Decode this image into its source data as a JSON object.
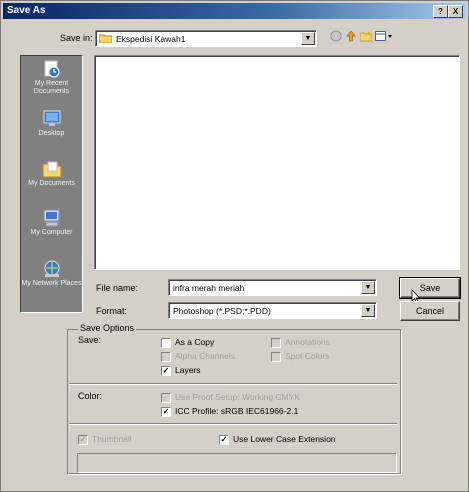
{
  "window": {
    "title": "Save As",
    "help_button": "?",
    "close_button": "X"
  },
  "save_in": {
    "label": "Save in:",
    "value": "Ekspedisi Kawah1"
  },
  "places": [
    {
      "label": "My Recent Documents",
      "icon": "recent-documents-icon"
    },
    {
      "label": "Desktop",
      "icon": "desktop-icon"
    },
    {
      "label": "My Documents",
      "icon": "my-documents-icon"
    },
    {
      "label": "My Computer",
      "icon": "my-computer-icon"
    },
    {
      "label": "My Network Places",
      "icon": "network-places-icon"
    }
  ],
  "file_name": {
    "label": "File name:",
    "value": "infra merah meriah"
  },
  "format": {
    "label": "Format:",
    "value": "Photoshop (*.PSD;*.PDD)"
  },
  "buttons": {
    "save": "Save",
    "cancel": "Cancel"
  },
  "save_options": {
    "group_label": "Save Options",
    "save_label": "Save:",
    "as_a_copy": {
      "label": "As a Copy",
      "checked": false,
      "enabled": true
    },
    "alpha_channels": {
      "label": "Alpha Channels",
      "checked": false,
      "enabled": false
    },
    "layers": {
      "label": "Layers",
      "checked": true,
      "enabled": true
    },
    "annotations": {
      "label": "Annotations",
      "checked": false,
      "enabled": false
    },
    "spot_colors": {
      "label": "Spot Colors",
      "checked": false,
      "enabled": false
    }
  },
  "color": {
    "label": "Color:",
    "use_proof_setup": {
      "label": "Use Proof Setup:  Working CMYK",
      "checked": false,
      "enabled": false
    },
    "icc_profile": {
      "label": "ICC Profile:  sRGB IEC61966-2.1",
      "checked": true,
      "enabled": true
    }
  },
  "thumbnail": {
    "label": "Thumbnail",
    "checked": true,
    "enabled": false
  },
  "use_lower_case": {
    "label": "Use Lower Case Extension",
    "checked": true,
    "enabled": true
  },
  "checkmark_glyph": "✓"
}
